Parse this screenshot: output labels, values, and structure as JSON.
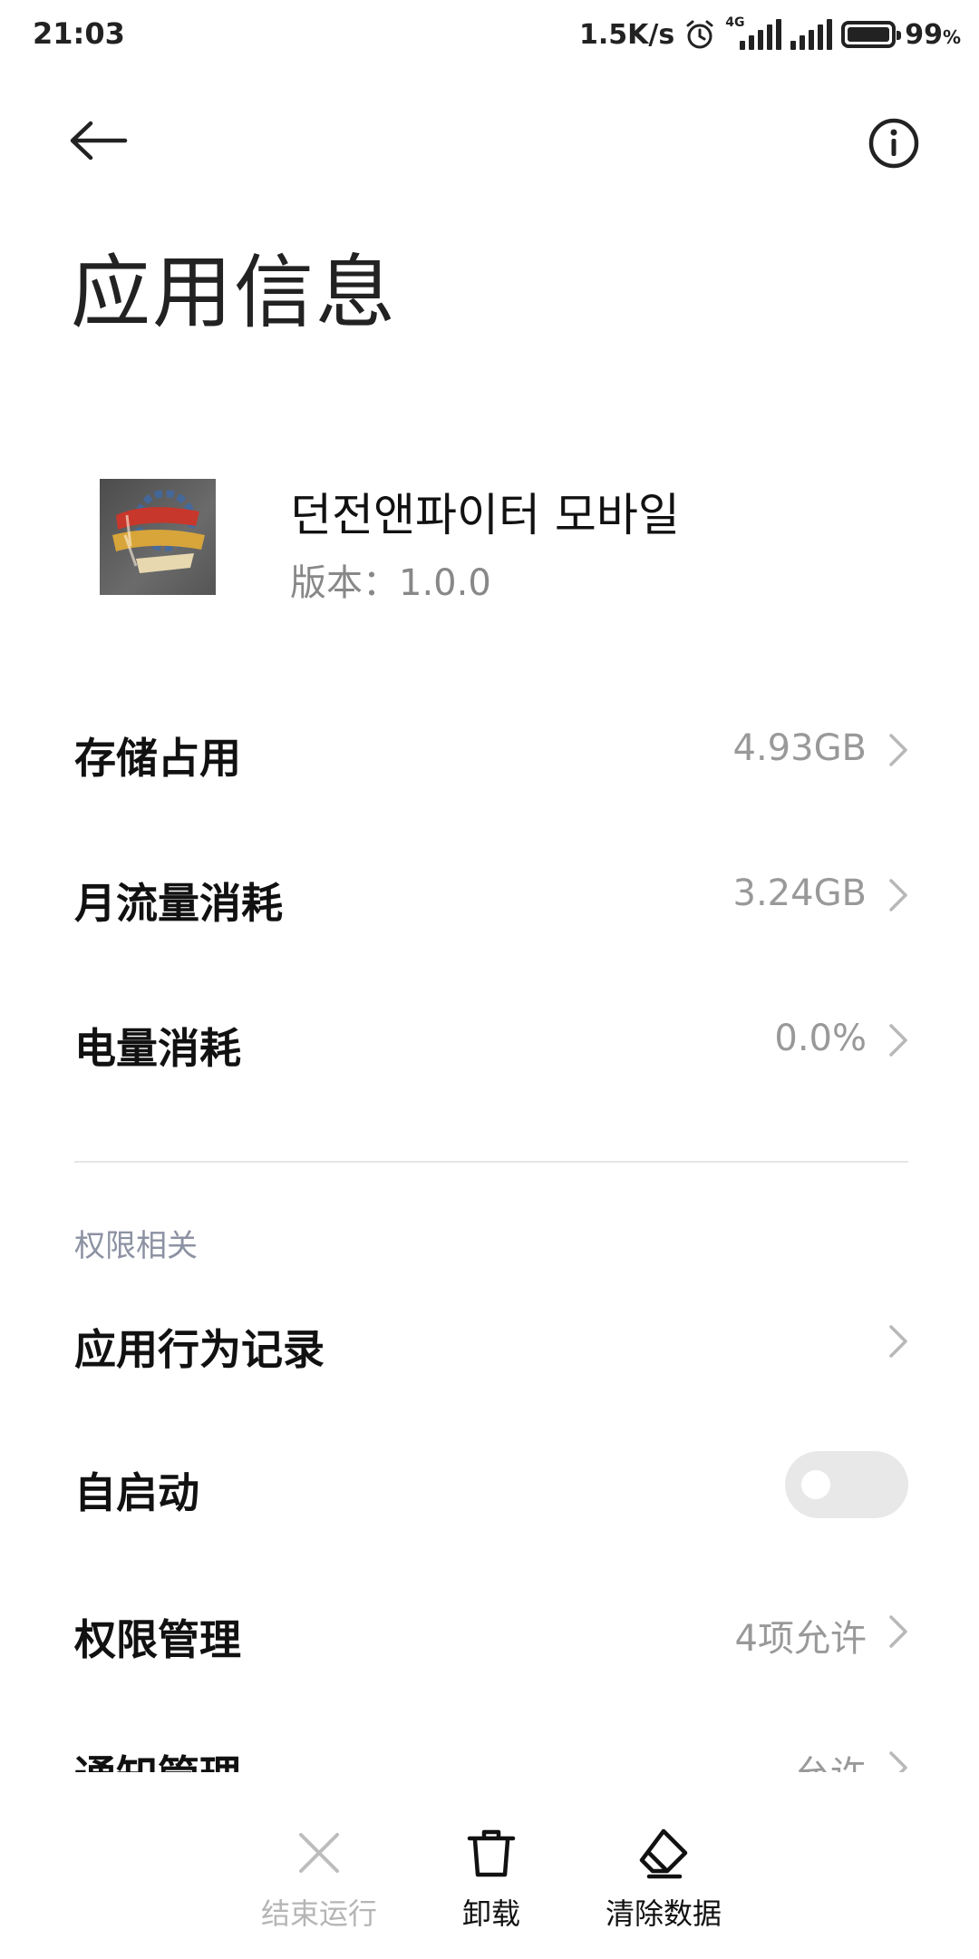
{
  "status_bar": {
    "time": "21:03",
    "net_speed": "1.5K/s",
    "network_tag": "4G",
    "battery_percent": "99",
    "battery_unit": "%",
    "battery_level": 0.99
  },
  "header": {
    "title": "应用信息"
  },
  "app": {
    "name": "던전앤파이터 모바일",
    "version": "版本：1.0.0"
  },
  "rows": {
    "storage": {
      "label": "存储占用",
      "value": "4.93GB"
    },
    "data_usage": {
      "label": "月流量消耗",
      "value": "3.24GB"
    },
    "battery": {
      "label": "电量消耗",
      "value": "0.0%"
    }
  },
  "permissions_section": {
    "title": "权限相关",
    "behavior_log": {
      "label": "应用行为记录"
    },
    "autostart": {
      "label": "自启动",
      "enabled": false
    },
    "permission_mgmt": {
      "label": "权限管理",
      "value": "4项允许"
    },
    "notification_mgmt": {
      "label": "通知管理",
      "value": "允许"
    }
  },
  "actions": {
    "force_stop": {
      "label": "结束运行",
      "enabled": false
    },
    "uninstall": {
      "label": "卸载"
    },
    "clear_data": {
      "label": "清除数据"
    }
  },
  "colors": {
    "accent_gray": "#8c92a3",
    "value_gray": "#999999",
    "toggle_off": "#e8e8e8"
  },
  "icons": {
    "back": "arrow-left-icon",
    "info": "info-circle-icon",
    "chevron": "chevron-right-icon",
    "force_stop": "close-icon",
    "uninstall": "trash-icon",
    "clear_data": "eraser-icon"
  }
}
